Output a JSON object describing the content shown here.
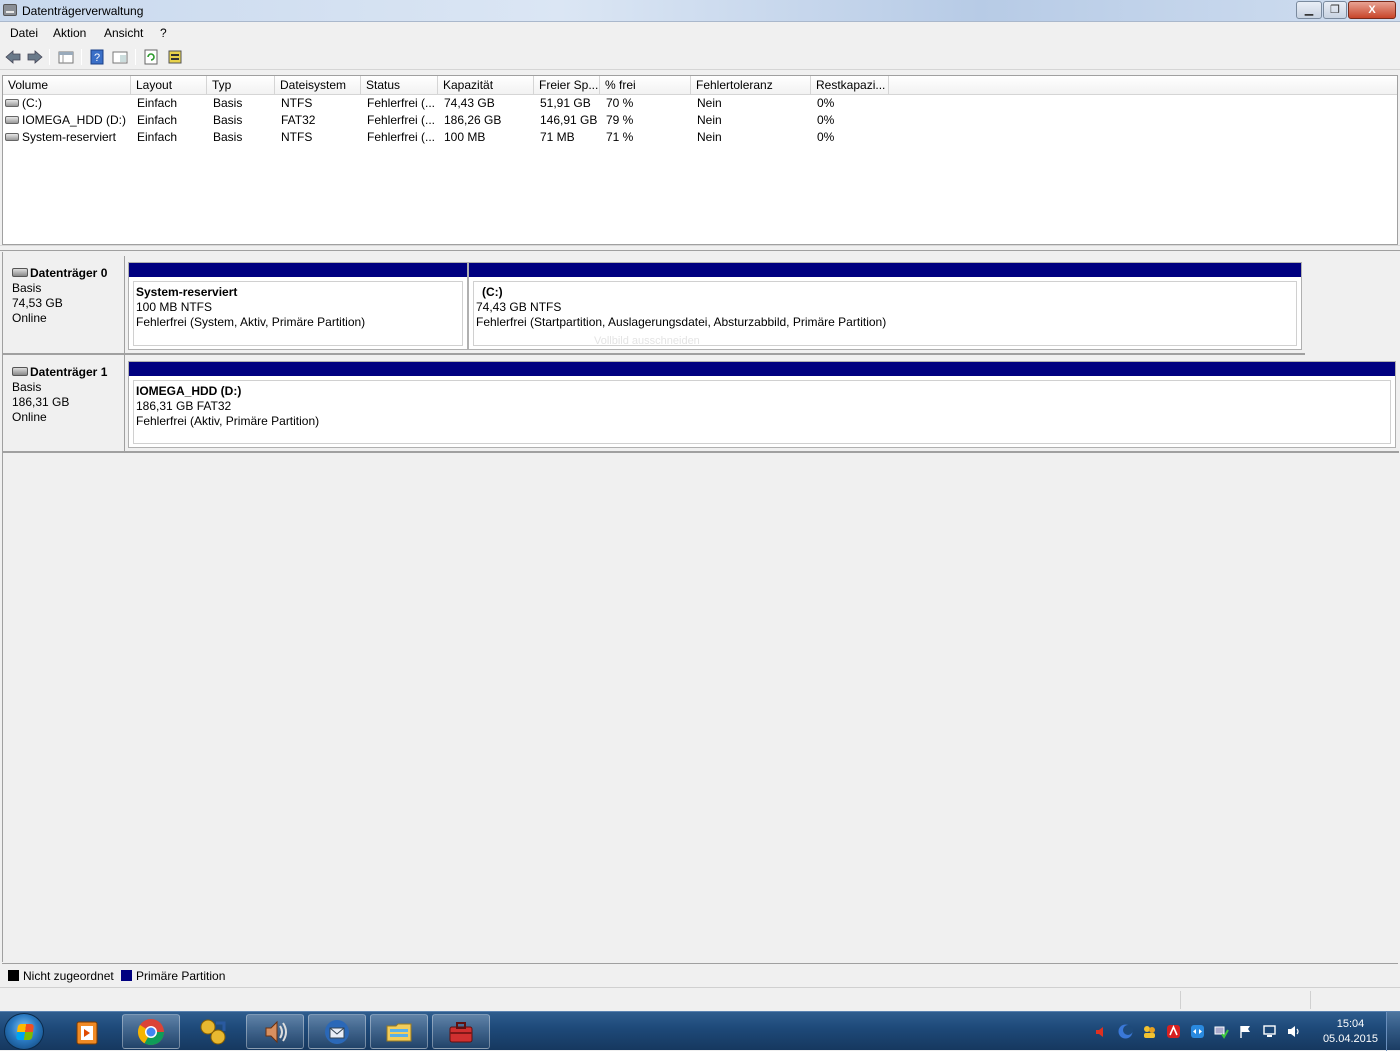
{
  "window": {
    "title": "Datenträgerverwaltung",
    "controls": {
      "minimize": "▁",
      "maximize": "❐",
      "close": "X"
    }
  },
  "menu": [
    "Datei",
    "Aktion",
    "Ansicht",
    "?"
  ],
  "toolbar": {
    "icons": [
      "back-arrow-icon",
      "forward-arrow-icon",
      "properties-icon",
      "help-icon",
      "view-icon",
      "refresh-icon",
      "rescan-icon"
    ]
  },
  "volume_list": {
    "columns": [
      "Volume",
      "Layout",
      "Typ",
      "Dateisystem",
      "Status",
      "Kapazität",
      "Freier Sp...",
      "% frei",
      "Fehlertoleranz",
      "Restkapazi..."
    ],
    "rows": [
      [
        "(C:)",
        "Einfach",
        "Basis",
        "NTFS",
        "Fehlerfrei (...",
        "74,43 GB",
        "51,91 GB",
        "70 %",
        "Nein",
        "0%"
      ],
      [
        "IOMEGA_HDD (D:)",
        "Einfach",
        "Basis",
        "FAT32",
        "Fehlerfrei (...",
        "186,26 GB",
        "146,91 GB",
        "79 %",
        "Nein",
        "0%"
      ],
      [
        "System-reserviert",
        "Einfach",
        "Basis",
        "NTFS",
        "Fehlerfrei (...",
        "100 MB",
        "71 MB",
        "71 %",
        "Nein",
        "0%"
      ]
    ]
  },
  "disks": [
    {
      "name": "Datenträger 0",
      "type": "Basis",
      "size": "74,53 GB",
      "state": "Online",
      "partitions": [
        {
          "name": "System-reserviert",
          "size_fs": "100 MB NTFS",
          "status": "Fehlerfrei (System, Aktiv, Primäre Partition)"
        },
        {
          "name": "(C:)",
          "size_fs": "74,43 GB NTFS",
          "status": "Fehlerfrei (Startpartition, Auslagerungsdatei, Absturzabbild, Primäre Partition)"
        }
      ]
    },
    {
      "name": "Datenträger 1",
      "type": "Basis",
      "size": "186,31 GB",
      "state": "Online",
      "partitions": [
        {
          "name": "IOMEGA_HDD  (D:)",
          "size_fs": "186,31 GB FAT32",
          "status": "Fehlerfrei (Aktiv, Primäre Partition)"
        }
      ]
    }
  ],
  "overlay_text": "Vollbild ausschneiden",
  "legend": [
    {
      "label": "Nicht zugeordnet",
      "color": "#000000"
    },
    {
      "label": "Primäre Partition",
      "color": "#000080"
    }
  ],
  "taskbar": {
    "apps": [
      "media-player-icon",
      "chrome-icon",
      "games-icon",
      "volume-app-icon",
      "thunderbird-icon",
      "explorer-icon",
      "toolbox-icon"
    ],
    "clock": {
      "time": "15:04",
      "date": "05.04.2015"
    }
  },
  "colors": {
    "primary_partition": "#000080",
    "unallocated": "#000000"
  }
}
